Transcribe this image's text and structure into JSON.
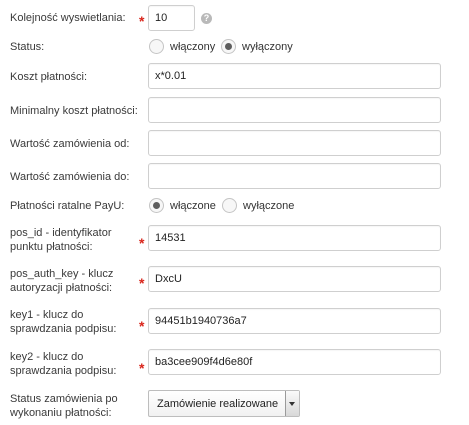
{
  "fields": {
    "display_order": {
      "label": "Kolejność wyswietlania:",
      "value": "10",
      "help": "?"
    },
    "status": {
      "label": "Status:",
      "options": [
        "włączony",
        "wyłączony"
      ],
      "selected": "wyłączony"
    },
    "payment_cost": {
      "label": "Koszt płatności:",
      "value": "x*0.01"
    },
    "min_payment_cost": {
      "label": "Minimalny koszt płatności:",
      "value": ""
    },
    "order_value_from": {
      "label": "Wartość zamówienia od:",
      "value": ""
    },
    "order_value_to": {
      "label": "Wartość zamówienia do:",
      "value": ""
    },
    "payu_installments": {
      "label": "Płatności ratalne PayU:",
      "options": [
        "włączone",
        "wyłączone"
      ],
      "selected": "włączone"
    },
    "pos_id": {
      "label": "pos_id - identyfikator punktu płatności:",
      "value": "14531"
    },
    "pos_auth_key": {
      "label": "pos_auth_key - klucz autoryzacji płatności:",
      "value": "DxcU"
    },
    "key1": {
      "label": "key1 - klucz do sprawdzania podpisu:",
      "value": "94451b1940736a7"
    },
    "key2": {
      "label": "key2 - klucz do sprawdzania podpisu:",
      "value": "ba3cee909f4d6e80f"
    },
    "order_status_after_payment": {
      "label": "Status zamówienia po wykonaniu płatności:",
      "value": "Zamówienie realizowane"
    }
  },
  "colors": {
    "required_marker": "#d9261c",
    "input_border": "#cfcfcf"
  },
  "icons": {
    "required": "asterisk",
    "help": "question-circle-icon"
  },
  "required_mark": "*"
}
